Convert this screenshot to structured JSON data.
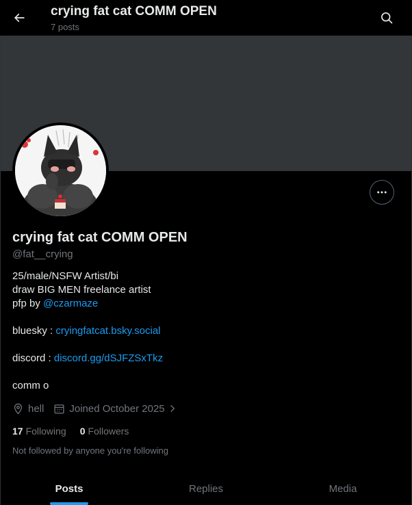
{
  "header": {
    "title": "crying fat cat COMM OPEN",
    "post_count": "7 posts"
  },
  "profile": {
    "display_name": "crying fat cat COMM OPEN",
    "handle": "@fat__crying",
    "bio": {
      "line1": "25/male/NSFW Artist/bi",
      "line2": "draw BIG MEN freelance artist",
      "line3_prefix": "pfp by ",
      "line3_link": "@czarmaze",
      "bluesky_label": "bluesky : ",
      "bluesky_link": "cryingfatcat.bsky.social",
      "discord_label": "discord : ",
      "discord_link": "discord.gg/dSJFZSxTkz",
      "last_line": "comm o"
    },
    "location": "hell",
    "joined": "Joined October 2025",
    "following_count": "17",
    "following_label": "Following",
    "followers_count": "0",
    "followers_label": "Followers",
    "not_followed_text": "Not followed by anyone you're following"
  },
  "tabs": [
    {
      "label": "Posts",
      "active": true
    },
    {
      "label": "Replies",
      "active": false
    },
    {
      "label": "Media",
      "active": false
    }
  ],
  "colors": {
    "background": "#000000",
    "banner": "#333639",
    "text_primary": "#e7e9ea",
    "text_secondary": "#71767b",
    "link": "#1d9bf0"
  },
  "icons": [
    "back-arrow-icon",
    "search-icon",
    "more-horizontal-icon",
    "location-pin-icon",
    "calendar-icon",
    "chevron-right-icon"
  ]
}
